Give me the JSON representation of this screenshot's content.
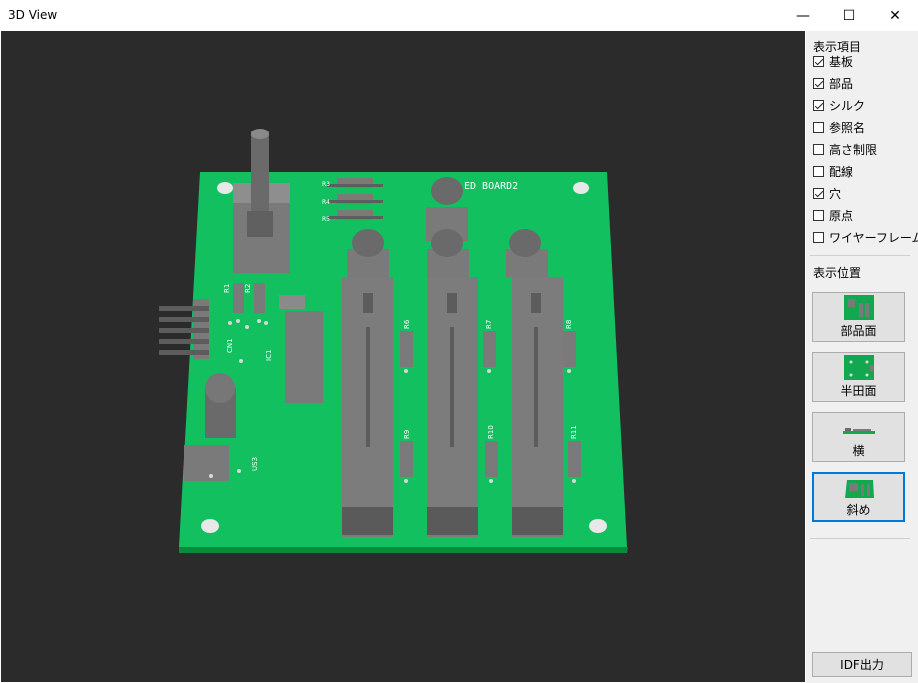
{
  "window": {
    "title": "3D View",
    "minimize_glyph": "—",
    "maximize_glyph": "☐",
    "close_glyph": "✕"
  },
  "board": {
    "silk_name": "ED BOARD2",
    "silk_labels": [
      "R1",
      "R2",
      "R3",
      "R4",
      "R5",
      "R6",
      "R7",
      "R8",
      "R9",
      "R10",
      "R11",
      "IC1",
      "CN1",
      "US3"
    ],
    "board_color": "#12c060",
    "edge_color": "#0a8a3c",
    "component_color": "#808080"
  },
  "sidebar": {
    "display_items_label": "表示項目",
    "display_items": [
      {
        "label": "基板",
        "checked": true
      },
      {
        "label": "部品",
        "checked": true
      },
      {
        "label": "シルク",
        "checked": true
      },
      {
        "label": "参照名",
        "checked": false
      },
      {
        "label": "高さ制限",
        "checked": false
      },
      {
        "label": "配線",
        "checked": false
      },
      {
        "label": "穴",
        "checked": true
      },
      {
        "label": "原点",
        "checked": false
      },
      {
        "label": "ワイヤーフレーム",
        "checked": false
      }
    ],
    "view_position_label": "表示位置",
    "view_buttons": [
      {
        "label": "部品面",
        "icon": "component-side-thumbnail",
        "active": false
      },
      {
        "label": "半田面",
        "icon": "solder-side-thumbnail",
        "active": false
      },
      {
        "label": "横",
        "icon": "side-view-thumbnail",
        "active": false
      },
      {
        "label": "斜め",
        "icon": "oblique-view-thumbnail",
        "active": true
      }
    ],
    "idf_button_label": "IDF出力"
  }
}
